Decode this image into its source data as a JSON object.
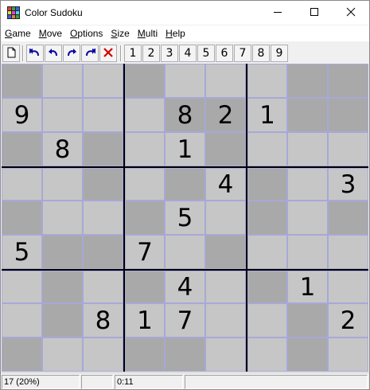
{
  "window": {
    "title": "Color Sudoku"
  },
  "menu": [
    {
      "label": "Game",
      "key": "G",
      "rest": "ame"
    },
    {
      "label": "Move",
      "key": "M",
      "rest": "ove"
    },
    {
      "label": "Options",
      "key": "O",
      "rest": "ptions"
    },
    {
      "label": "Size",
      "key": "S",
      "rest": "ize"
    },
    {
      "label": "Multi",
      "key": "M",
      "rest": "ulti"
    },
    {
      "label": "Help",
      "key": "H",
      "rest": "elp"
    }
  ],
  "toolbar": {
    "icons": [
      "new-game-icon",
      "undo-all-icon",
      "undo-icon",
      "redo-icon",
      "redo-all-icon",
      "clear-icon"
    ],
    "numbers": [
      "1",
      "2",
      "3",
      "4",
      "5",
      "6",
      "7",
      "8",
      "9"
    ]
  },
  "board": {
    "colors": {
      "light": "#c6c6c6",
      "dark": "#a9a9a9",
      "cell_border": "#a8a8d8",
      "block_border": "#000000"
    },
    "shading": [
      "DLLDLLLDD",
      "LLLLDDLDD",
      "DLDLLDLLL",
      "LLDLDLDLL",
      "DLLDLLDLD",
      "LDDLLDLLL",
      "LDLDLLDLL",
      "LDLLLLLDL",
      "DLLDDLLDL"
    ],
    "digits": [
      [
        "",
        "",
        "",
        "",
        "",
        "",
        "",
        "",
        ""
      ],
      [
        "9",
        "",
        "",
        "",
        "8",
        "2",
        "1",
        "",
        ""
      ],
      [
        "",
        "8",
        "",
        "",
        "1",
        "",
        "",
        "",
        ""
      ],
      [
        "",
        "",
        "",
        "",
        "",
        "4",
        "",
        "",
        "3"
      ],
      [
        "",
        "",
        "",
        "",
        "5",
        "",
        "",
        "",
        ""
      ],
      [
        "5",
        "",
        "",
        "7",
        "",
        "",
        "",
        "",
        ""
      ],
      [
        "",
        "",
        "",
        "",
        "4",
        "",
        "",
        "1",
        ""
      ],
      [
        "",
        "",
        "8",
        "1",
        "7",
        "",
        "",
        "",
        "2"
      ],
      [
        "",
        "",
        "",
        "",
        "",
        "",
        "",
        "",
        ""
      ]
    ]
  },
  "status": {
    "filled": "17  (20%)",
    "field2": "",
    "time": "0:11",
    "field4": ""
  }
}
